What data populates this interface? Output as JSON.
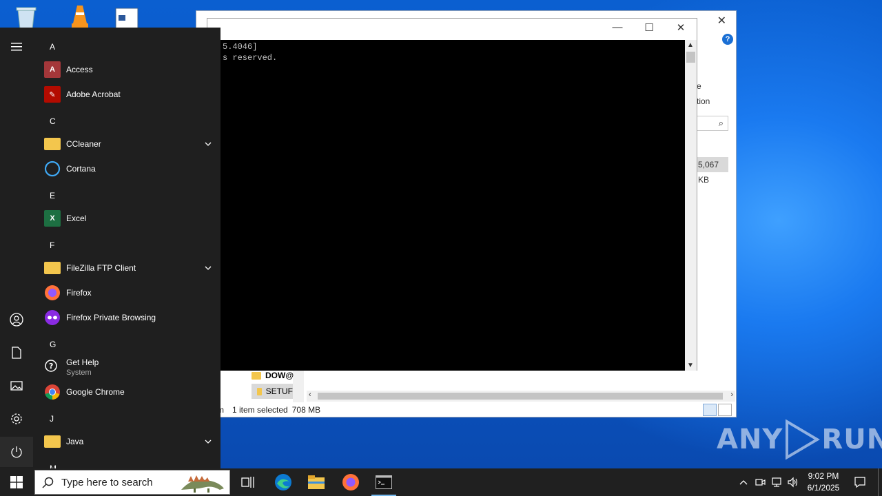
{
  "console": {
    "line1": "5.4046]",
    "line2": "s reserved."
  },
  "explorer": {
    "ribbon_line1": "e",
    "ribbon_line2": "tion",
    "size_cell": "5,067 KB",
    "rows": [
      {
        "name": "DOW@"
      },
      {
        "name": "SETUF"
      }
    ],
    "status_items": "m",
    "status_selected": "1 item selected",
    "status_size": "708 MB"
  },
  "start_menu": {
    "groups": [
      {
        "letter": "A",
        "apps": [
          {
            "label": "Access",
            "icon": "access-icon"
          },
          {
            "label": "Adobe Acrobat",
            "icon": "acrobat-icon"
          }
        ]
      },
      {
        "letter": "C",
        "apps": [
          {
            "label": "CCleaner",
            "icon": "folder-icon",
            "expandable": true
          },
          {
            "label": "Cortana",
            "icon": "cortana-icon"
          }
        ]
      },
      {
        "letter": "E",
        "apps": [
          {
            "label": "Excel",
            "icon": "excel-icon"
          }
        ]
      },
      {
        "letter": "F",
        "apps": [
          {
            "label": "FileZilla FTP Client",
            "icon": "folder-icon",
            "expandable": true
          },
          {
            "label": "Firefox",
            "icon": "firefox-icon"
          },
          {
            "label": "Firefox Private Browsing",
            "icon": "firefox-private-icon"
          }
        ]
      },
      {
        "letter": "G",
        "apps": [
          {
            "label": "Get Help",
            "sub": "System",
            "icon": "get-help-icon"
          },
          {
            "label": "Google Chrome",
            "icon": "chrome-icon"
          }
        ]
      },
      {
        "letter": "J",
        "apps": [
          {
            "label": "Java",
            "icon": "folder-icon",
            "expandable": true
          }
        ]
      },
      {
        "letter": "M",
        "apps": []
      }
    ]
  },
  "taskbar": {
    "search_placeholder": "Type here to search",
    "time": "9:02 PM",
    "date": "6/1/2025"
  },
  "watermark": {
    "left": "ANY",
    "right": "RUN"
  },
  "colors": {
    "start_bg": "#1f1f1f",
    "taskbar_bg": "#202020",
    "console_bg": "#000000",
    "accent": "#76b9ed"
  }
}
